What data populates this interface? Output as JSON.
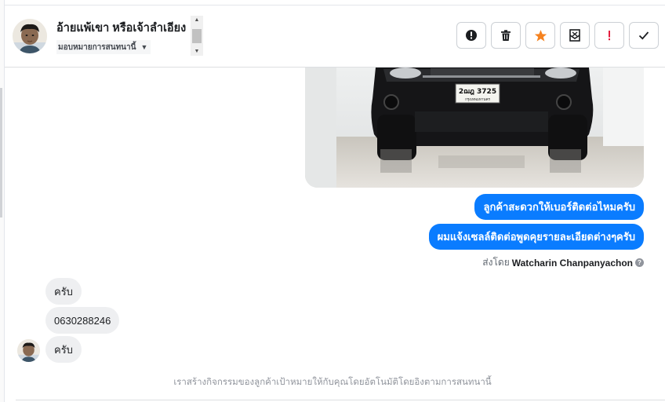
{
  "header": {
    "contact_name": "อ้ายแพ้เขา หรือเจ้าลำเอียง",
    "assign_label": "มอบหมายการสนทนานี้",
    "actions": [
      {
        "name": "report-spam-button",
        "icon": "alert-circle-icon"
      },
      {
        "name": "delete-button",
        "icon": "trash-icon"
      },
      {
        "name": "star-button",
        "icon": "star-icon"
      },
      {
        "name": "mark-unread-button",
        "icon": "envelope-icon"
      },
      {
        "name": "follow-up-button",
        "icon": "exclamation-icon"
      },
      {
        "name": "mark-done-button",
        "icon": "check-icon"
      }
    ]
  },
  "image_message": {
    "plate_text": "2ฌฎ 3725",
    "plate_province": "กรุงเทพมหานคร"
  },
  "outgoing": [
    {
      "text": "ลูกค้าสะดวกให้เบอร์ติดต่อไหมครับ"
    },
    {
      "text": "ผมแจ้งเซลล์ติดต่อพูดคุยรายละเอียดต่างๆครับ"
    }
  ],
  "sent_by": {
    "prefix": "ส่งโดย",
    "name": "Watcharin Chanpanyachon"
  },
  "incoming": [
    {
      "text": "ครับ"
    },
    {
      "text": "0630288246"
    },
    {
      "text": "ครับ"
    }
  ],
  "footer_notice": "เราสร้างกิจกรรมของลูกค้าเป้าหมายให้กับคุณโดยอัตโนมัติโดยอิงตามการสนทนานี้",
  "colors": {
    "accent": "#0a7cff",
    "star": "#f5821f",
    "flag": "#e41e3f",
    "incoming_bubble": "#eeeff1"
  }
}
